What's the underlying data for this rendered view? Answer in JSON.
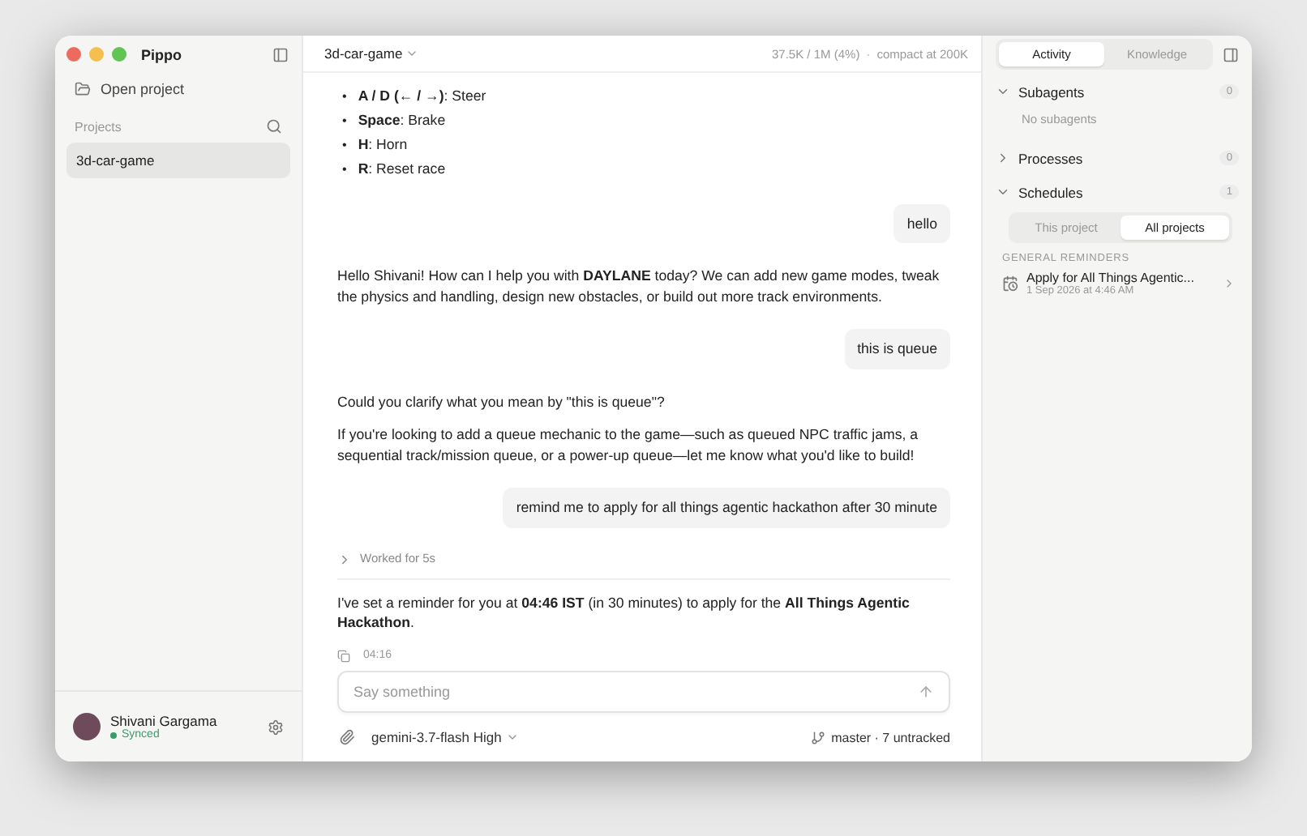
{
  "window": {
    "title": "Pippo"
  },
  "sidebar": {
    "open_project": "Open project",
    "projects_label": "Projects",
    "projects": [
      {
        "name": "3d-car-game",
        "selected": true
      }
    ],
    "user": {
      "name": "Shivani Gargama",
      "status": "Synced"
    }
  },
  "header": {
    "project": "3d-car-game",
    "usage": "37.5K / 1M (4%)",
    "separator": "·",
    "compact": "compact at 200K"
  },
  "messages": [
    {
      "kind": "bullets",
      "marker": "•",
      "items": [
        "**A / D (← / →)**: Steer",
        "**Space**: Brake",
        "**H**: Horn",
        "**R**: Reset race"
      ]
    },
    {
      "kind": "user",
      "text": "hello"
    },
    {
      "kind": "assistant",
      "paragraphs": [
        "Hello Shivani! How can I help you with **DAYLANE** today? We can add new game modes, tweak the physics and handling, design new obstacles, or build out more track environments."
      ]
    },
    {
      "kind": "user",
      "text": "this is queue"
    },
    {
      "kind": "assistant",
      "paragraphs": [
        "Could you clarify what you mean by \"this is queue\"?",
        "If you're looking to add a queue mechanic to the game—such as queued NPC traffic jams, a sequential track/mission queue, or a power-up queue—let me know what you'd like to build!"
      ]
    },
    {
      "kind": "user",
      "text": "remind me to apply for all things agentic hackathon after 30 minute"
    },
    {
      "kind": "worked",
      "text": "Worked for 5s",
      "expanded": false
    },
    {
      "kind": "assistant",
      "paragraphs": [
        "I've set a reminder for you at **04:46 IST** (in 30 minutes) to apply for the **All Things Agentic Hackathon**."
      ],
      "time": "04:16"
    }
  ],
  "composer": {
    "placeholder": "Say something",
    "model": "gemini-3.7-flash High",
    "branch": "master · 7 untracked"
  },
  "panel": {
    "tabs": [
      {
        "label": "Activity",
        "selected": true
      },
      {
        "label": "Knowledge",
        "selected": false
      }
    ],
    "sections": [
      {
        "title": "Subagents",
        "count": "0",
        "expanded": true,
        "empty": "No subagents"
      },
      {
        "title": "Processes",
        "count": "0",
        "expanded": false
      },
      {
        "title": "Schedules",
        "count": "1",
        "expanded": true,
        "filters": [
          {
            "label": "This project",
            "selected": false
          },
          {
            "label": "All projects",
            "selected": true
          }
        ],
        "group": "GENERAL REMINDERS",
        "reminders": [
          {
            "title": "Apply for All Things Agentic...",
            "date": "1 Sep 2026 at 4:46 AM"
          }
        ]
      }
    ]
  }
}
